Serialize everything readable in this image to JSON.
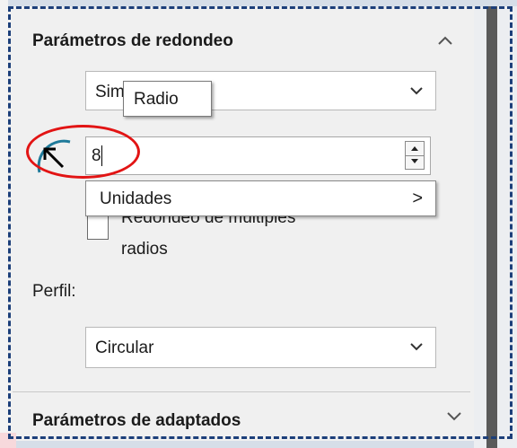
{
  "panel": {
    "rounding_section_title": "Parámetros de redondeo",
    "type_dropdown": {
      "value": "Sim"
    },
    "tooltip": "Radio",
    "radius_input": {
      "value": "8"
    },
    "units_menu": {
      "label": "Unidades",
      "submenu_glyph": ">"
    },
    "multi_radius_checkbox": {
      "label_line1": "Redondeo de múltiples",
      "label_line2": "radios",
      "checked": false
    },
    "profile_label": "Perfil:",
    "profile_dropdown": {
      "value": "Circular"
    },
    "adapted_section_title": "Parámetros de adaptados"
  },
  "colors": {
    "highlight_oval": "#e21414",
    "dashed_border": "#1c3f7a",
    "icon_teal": "#1f7a9a"
  },
  "icons": [
    "chevron-up-icon",
    "chevron-down-icon",
    "radius-icon",
    "spin-up-icon",
    "spin-down-icon"
  ]
}
